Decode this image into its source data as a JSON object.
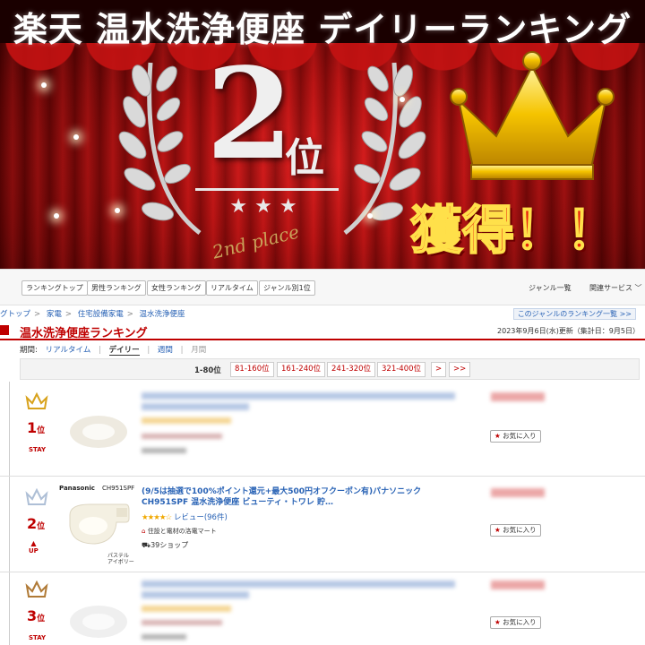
{
  "banner": {
    "title": "楽天 温水洗浄便座 デイリーランキング",
    "rank_number": "2",
    "rank_unit": "位",
    "stars": "★★★",
    "place_text": "2nd place",
    "achieved": "獲得！！"
  },
  "subnav": {
    "buttons": [
      "ランキングトップ",
      "男性ランキング",
      "女性ランキング",
      "リアルタイム",
      "ジャンル別1位"
    ],
    "genre_list": "ジャンル一覧",
    "related": "関連サービス ﹀"
  },
  "breadcrumb": {
    "items": [
      "グトップ",
      "家電",
      "住宅設備家電",
      "温水洗浄便座"
    ],
    "separator": ">",
    "genre_ranking_list": "このジャンルのランキング一覧 >>"
  },
  "ranking": {
    "title": "温水洗浄便座ランキング",
    "updated": "2023年9月6日(水)更新（集計日：9月5日）",
    "period_label": "期間:",
    "periods": [
      "リアルタイム",
      "デイリー",
      "週間",
      "月間"
    ],
    "separator": "|",
    "pager_current": "1-80位",
    "pager_links": [
      "81-160位",
      "161-240位",
      "241-320位",
      "321-400位",
      ">",
      ">>"
    ]
  },
  "items": [
    {
      "rank": "1",
      "rank_unit": "位",
      "status": "STAY",
      "crown_color": "#d8a21c",
      "fav_label": "お気に入り",
      "star_icon": "star-icon"
    },
    {
      "rank": "2",
      "rank_unit": "位",
      "status": "UP",
      "crown_color": "#aebfd6",
      "brand": "Panasonic",
      "model": "CH951SPF",
      "color_note": "パステル\nアイボリー",
      "name": "(9/5は抽選で100%ポイント還元+最大500円オフクーポン有)パナソニック CH951SPF 温水洗浄便座 ビューティ・トワレ 貯…",
      "stars": "★★★★☆",
      "review": "レビュー(96件)",
      "mark": "住設と電材の洛電マート",
      "shops": "39ショップ",
      "fav_label": "お気に入り"
    },
    {
      "rank": "3",
      "rank_unit": "位",
      "status": "STAY",
      "crown_color": "#b07a36",
      "fav_label": "お気に入り"
    }
  ],
  "colors": {
    "rakuten_red": "#bf0000",
    "link_blue": "#2862b5",
    "gold": "#f5c400"
  }
}
